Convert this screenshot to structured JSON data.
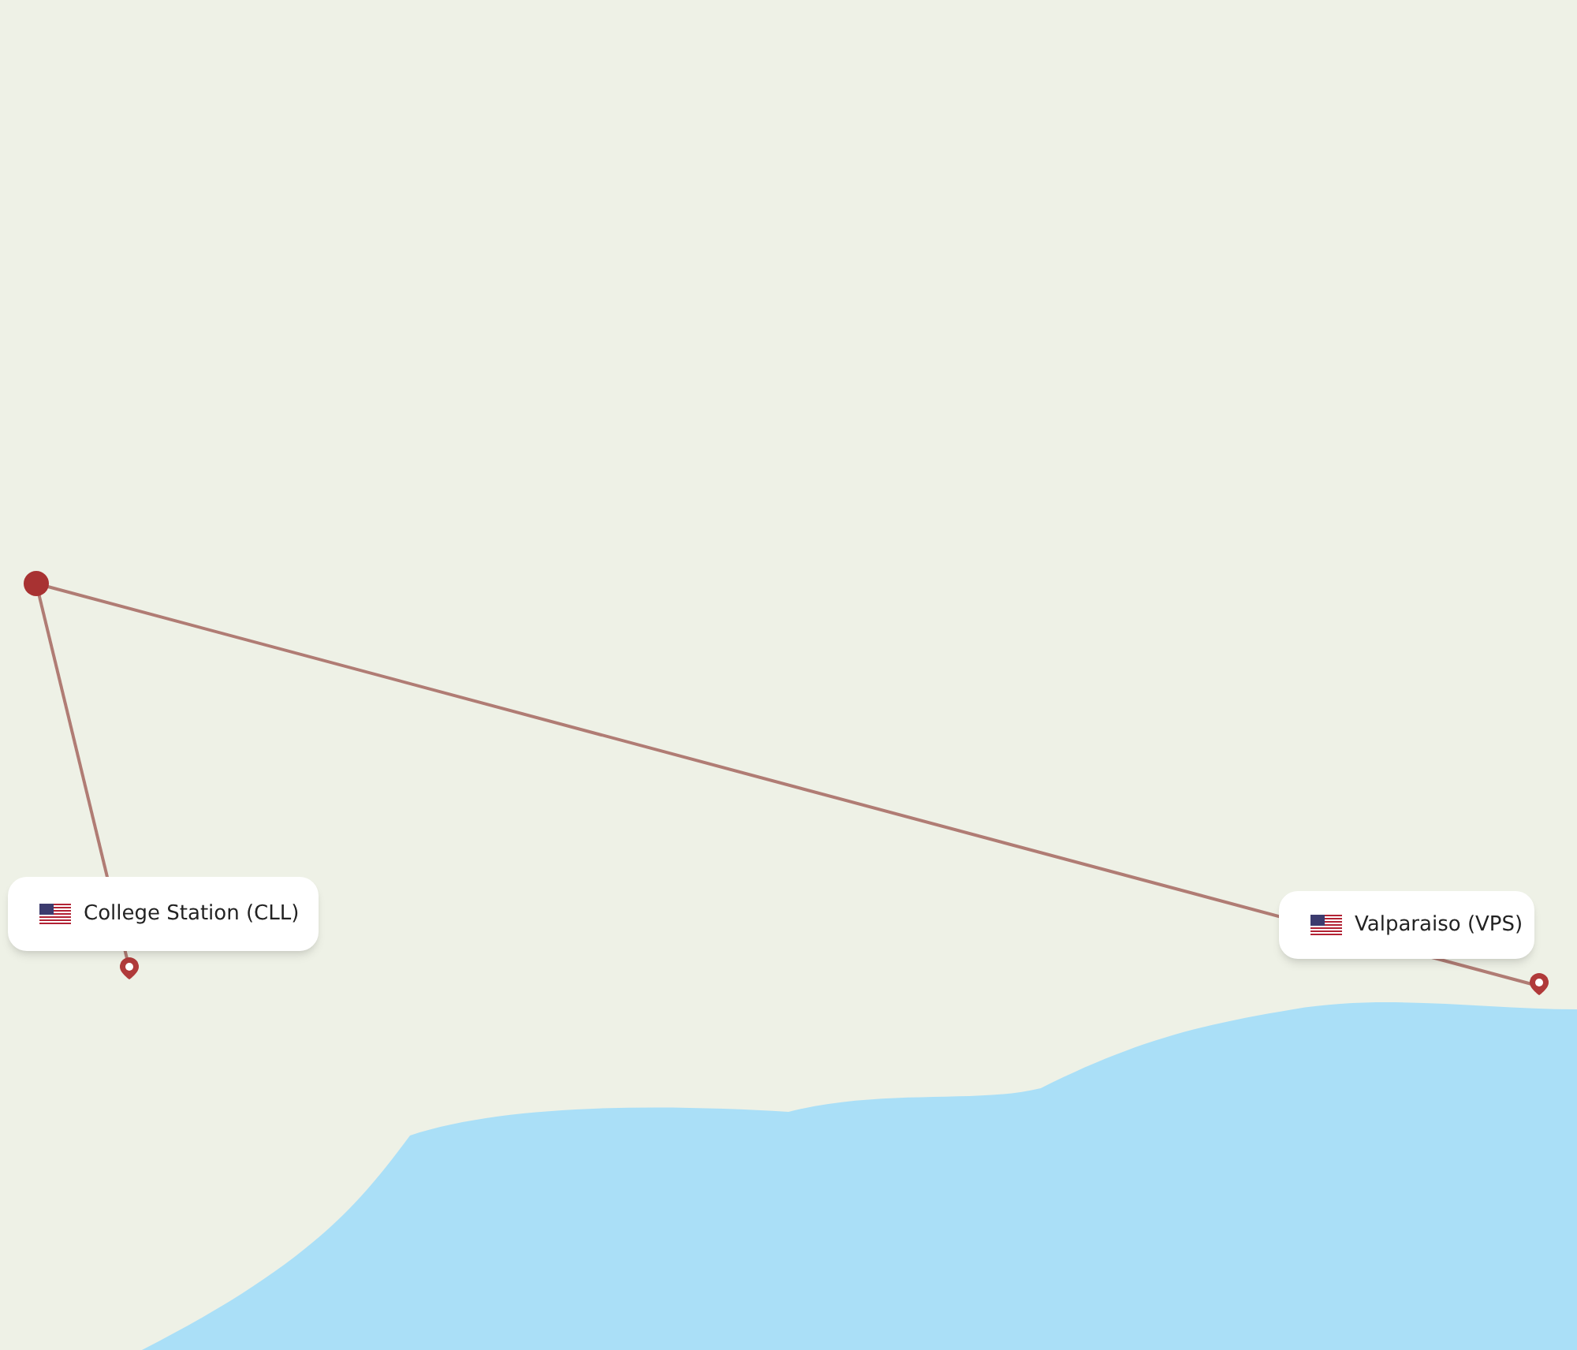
{
  "map": {
    "callouts": [
      {
        "label": "College Station (CLL)"
      },
      {
        "label": "Valparaiso (VPS)"
      }
    ]
  }
}
